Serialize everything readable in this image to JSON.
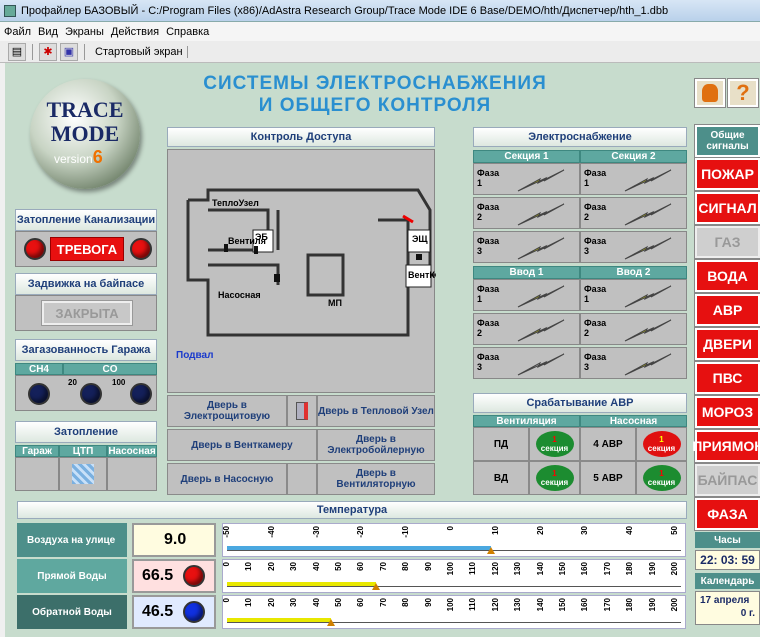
{
  "window": {
    "title": "Профайлер БАЗОВЫЙ - C:/Program Files (x86)/AdAstra Research Group/Trace Mode IDE 6 Base/DEMO/hth/Диспетчер/hth_1.dbb"
  },
  "menu": [
    "Файл",
    "Вид",
    "Экраны",
    "Действия",
    "Справка"
  ],
  "toolbar": {
    "screen_label": "Стартовый экран"
  },
  "header": {
    "line1": "СИСТЕМЫ ЭЛЕКТРОСНАБЖЕНИЯ",
    "line2": "И ОБЩЕГО КОНТРОЛЯ"
  },
  "logo": {
    "line1": "TRACE",
    "line2": "MODE",
    "line3": "version",
    "ver": "6"
  },
  "help": {
    "label": "?"
  },
  "flood_sewer": {
    "title": "Затопление Канализации",
    "alarm": "ТРЕВОГА"
  },
  "bypass_valve": {
    "title": "Задвижка на байпасе",
    "state": "ЗАКРЫТА"
  },
  "garage_gas": {
    "title": "Загазованность Гаража",
    "cols": [
      "CH4",
      "CO"
    ],
    "vals": [
      "20",
      "100"
    ]
  },
  "flooding": {
    "title": "Затопление",
    "cols": [
      "Гараж",
      "ЦТП",
      "Насосная"
    ]
  },
  "access": {
    "title": "Контроль Доступа",
    "basement": "Подвал",
    "rooms": [
      "ТеплоУзел",
      "ЭБ",
      "Вентиля",
      "Насосная",
      "ЭЩ",
      "ВентК",
      "МП"
    ],
    "doors": [
      "Дверь в Электрощитовую",
      "Дверь в Тепловой Узел",
      "Дверь в Венткамеру",
      "Дверь в Электробойлерную",
      "Дверь в Насосную",
      "Дверь в Вентиляторную"
    ]
  },
  "power": {
    "title": "Электроснабжение",
    "sec1": "Секция 1",
    "sec2": "Секция 2",
    "in1": "Ввод 1",
    "in2": "Ввод 2",
    "phase": "Фаза"
  },
  "avr": {
    "title": "Срабатывание АВР",
    "vent": "Вентиляция",
    "pump": "Насосная",
    "pd": "ПД",
    "vd": "ВД",
    "a4": "4 АВР",
    "a5": "5 АВР",
    "sec": "секция",
    "one": "1"
  },
  "signals": {
    "title": "Общие сигналы",
    "items": [
      "ПОЖАР",
      "СИГНАЛ",
      "ГАЗ",
      "ВОДА",
      "АВР",
      "ДВЕРИ",
      "ПВС",
      "МОРОЗ",
      "ПРИЯМОК",
      "БАЙПАС",
      "ФАЗА"
    ]
  },
  "clock": {
    "label": "Часы",
    "time": "22: 03: 59",
    "cal_label": "Календарь",
    "date1": "17 апреля",
    "date2": "0  г."
  },
  "temps": {
    "title": "Температура",
    "outside": {
      "label": "Воздуха на улице",
      "value": "9.0"
    },
    "supply": {
      "label": "Прямой Воды",
      "value": "66.5"
    },
    "return": {
      "label": "Обратной Воды",
      "value": "46.5"
    },
    "scale1": [
      "-50",
      "-40",
      "-30",
      "-20",
      "-10",
      "0",
      "10",
      "20",
      "30",
      "40",
      "50"
    ],
    "scale2": [
      "0",
      "10",
      "20",
      "30",
      "40",
      "50",
      "60",
      "70",
      "80",
      "90",
      "100",
      "110",
      "120",
      "130",
      "140",
      "150",
      "160",
      "170",
      "180",
      "190",
      "200"
    ],
    "colors": {
      "outside_bar": "#4aa8e0",
      "supply_bar": "#e8e800",
      "return_bar": "#e8e800"
    }
  }
}
